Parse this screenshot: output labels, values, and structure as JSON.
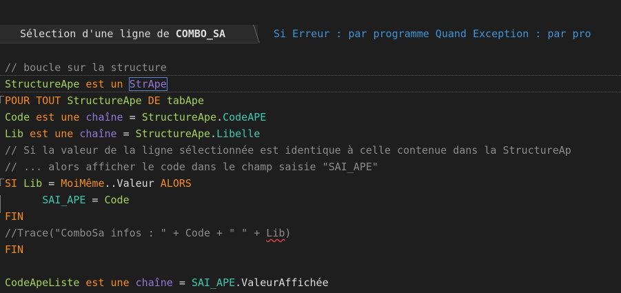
{
  "header": {
    "tab_prefix": "Sélection d'une ligne de ",
    "tab_control": "COMBO_SA",
    "proc_info": "Si Erreur : par programme  Quand Exception : par pro"
  },
  "code": {
    "l1_comment": "// boucle sur la structure",
    "l2_var": "StructureApe",
    "l2_kw": " est un ",
    "l2_type": "StrApe",
    "l3_kw1": "POUR TOUT ",
    "l3_var": "StructureApe",
    "l3_kw2": " DE ",
    "l3_src": "tabApe",
    "l4_var": "Code",
    "l4_kw": " est une ",
    "l4_type": "chaîne",
    "l4_eq": " = ",
    "l4_struct": "StructureApe",
    "l4_dot": ".",
    "l4_prop": "CodeAPE",
    "l5_var": "Lib",
    "l5_kw": " est une ",
    "l5_type": "chaîne",
    "l5_eq": " = ",
    "l5_struct": "StructureApe",
    "l5_dot": ".",
    "l5_prop": "Libelle",
    "l6_comment": "// Si la valeur de la ligne sélectionnée est identique à celle contenue dans la StructureAp",
    "l7_comment": "// ... alors afficher le code dans le champ saisie \"SAI_APE\"",
    "l8_si": "SI ",
    "l8_var": "Lib",
    "l8_eq": " = ",
    "l8_obj": "MoiMême",
    "l8_prop": "..Valeur ",
    "l8_alors": "ALORS",
    "l9_indent": "      ",
    "l9_ctl": "SAI_APE",
    "l9_eq": " = ",
    "l9_var": "Code",
    "l10_fin": "FIN",
    "l11_comment_pre": "//Trace(\"ComboSa infos : \" + Code + \" \" + ",
    "l11_comment_sq": "Lib",
    "l11_comment_post": ")",
    "l12_fin": "FIN",
    "l14_var": "CodeApeListe",
    "l14_kw": " est une ",
    "l14_type": "chaîne",
    "l14_eq": " = ",
    "l14_ctl": "SAI_APE",
    "l14_prop": ".ValeurAffichée"
  },
  "colors": {
    "background": "#1e1e1e",
    "keyword": "#f58b1f",
    "variable": "#a3d158",
    "type": "#8e7ad9",
    "property": "#3dc9b0",
    "comment": "#8c8c8c",
    "header_info": "#3d94d8"
  }
}
